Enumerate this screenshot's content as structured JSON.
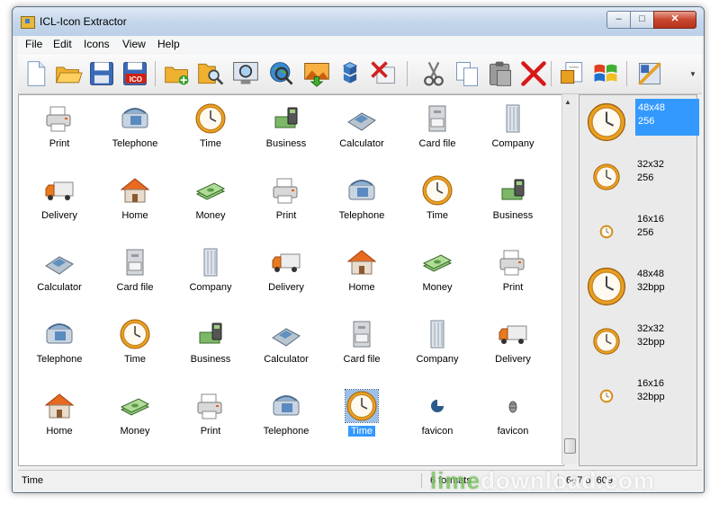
{
  "window": {
    "title": "ICL-Icon Extractor",
    "min": "–",
    "max": "□",
    "close": "✕"
  },
  "menu": [
    "File",
    "Edit",
    "Icons",
    "View",
    "Help"
  ],
  "toolbar": {
    "icons": [
      "new-icon",
      "open-folder-icon",
      "save-icon",
      "save-ico-icon",
      "add-folder-icon",
      "search-folder-icon",
      "search-screen-icon",
      "web-search-icon",
      "import-image-icon",
      "cubes-icon",
      "remove-icon",
      "cut-icon",
      "copy-icon",
      "paste-icon",
      "delete-icon",
      "properties-icon",
      "windows-logo-icon",
      "settings-icon"
    ]
  },
  "colors": {
    "selection": "#3399ff",
    "clock": "#e8a020"
  },
  "icons_grid": [
    {
      "label": "Print",
      "icon": "printer-icon"
    },
    {
      "label": "Telephone",
      "icon": "telephone-icon"
    },
    {
      "label": "Time",
      "icon": "clock-icon"
    },
    {
      "label": "Business",
      "icon": "business-icon"
    },
    {
      "label": "Calculator",
      "icon": "calculator-icon"
    },
    {
      "label": "Card file",
      "icon": "card-file-icon"
    },
    {
      "label": "Company",
      "icon": "building-icon"
    },
    {
      "label": "Delivery",
      "icon": "truck-icon"
    },
    {
      "label": "Home",
      "icon": "house-icon"
    },
    {
      "label": "Money",
      "icon": "money-icon"
    },
    {
      "label": "Print",
      "icon": "printer-icon"
    },
    {
      "label": "Telephone",
      "icon": "telephone-icon"
    },
    {
      "label": "Time",
      "icon": "clock-icon"
    },
    {
      "label": "Business",
      "icon": "business-icon"
    },
    {
      "label": "Calculator",
      "icon": "calculator-icon"
    },
    {
      "label": "Card file",
      "icon": "card-file-icon"
    },
    {
      "label": "Company",
      "icon": "building-icon"
    },
    {
      "label": "Delivery",
      "icon": "truck-icon"
    },
    {
      "label": "Home",
      "icon": "house-icon"
    },
    {
      "label": "Money",
      "icon": "money-icon"
    },
    {
      "label": "Print",
      "icon": "printer-icon"
    },
    {
      "label": "Telephone",
      "icon": "telephone-icon"
    },
    {
      "label": "Time",
      "icon": "clock-icon"
    },
    {
      "label": "Business",
      "icon": "business-icon"
    },
    {
      "label": "Calculator",
      "icon": "calculator-icon"
    },
    {
      "label": "Card file",
      "icon": "card-file-icon"
    },
    {
      "label": "Company",
      "icon": "building-icon"
    },
    {
      "label": "Delivery",
      "icon": "truck-icon"
    },
    {
      "label": "Home",
      "icon": "house-icon"
    },
    {
      "label": "Money",
      "icon": "money-icon"
    },
    {
      "label": "Print",
      "icon": "printer-icon"
    },
    {
      "label": "Telephone",
      "icon": "telephone-icon"
    },
    {
      "label": "Time",
      "icon": "clock-icon",
      "selected": true
    },
    {
      "label": "favicon",
      "icon": "favicon-pie-icon"
    },
    {
      "label": "favicon",
      "icon": "favicon-bug-icon"
    }
  ],
  "formats": [
    {
      "size": "48x48",
      "depth": "256",
      "selected": true
    },
    {
      "size": "32x32",
      "depth": "256"
    },
    {
      "size": "16x16",
      "depth": "256"
    },
    {
      "size": "48x48",
      "depth": "32bpp"
    },
    {
      "size": "32x32",
      "depth": "32bpp"
    },
    {
      "size": "16x16",
      "depth": "32bpp"
    }
  ],
  "status": {
    "name": "Time",
    "formats": "6 formats",
    "position": "607 of 609"
  },
  "watermark": {
    "prefix": "lime",
    "suffix": "download.com"
  }
}
